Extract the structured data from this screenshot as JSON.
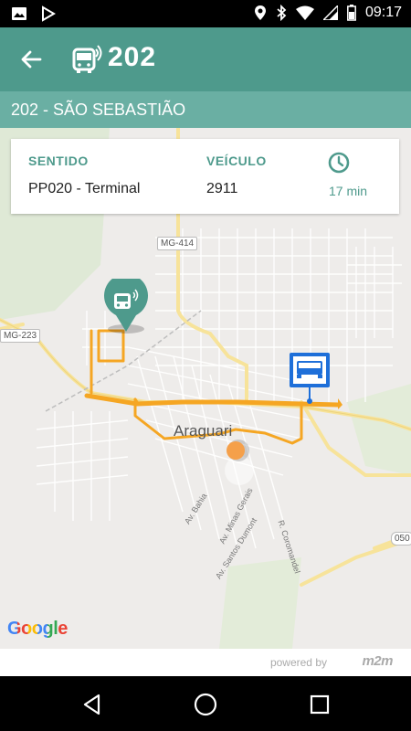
{
  "status_bar": {
    "time": "09:17",
    "icons": [
      "image-icon",
      "play-store-icon",
      "location-icon",
      "bluetooth-icon",
      "wifi-icon",
      "signal-icon",
      "battery-icon"
    ]
  },
  "header": {
    "route_number": "202",
    "back_icon": "arrow-left-icon",
    "logo_icon": "bus-signal-icon"
  },
  "route": {
    "name": "202 - SÃO SEBASTIÃO"
  },
  "info_card": {
    "direction_label": "SENTIDO",
    "direction_value": "PP020 - Terminal",
    "vehicle_label": "VEÍCULO",
    "vehicle_value": "2911",
    "eta_icon": "clock-icon",
    "eta_value": "17 min"
  },
  "map": {
    "city": "Araguari",
    "roads": [
      "MG-414",
      "MG-223",
      "050"
    ],
    "streets": [
      "Av. Bahia",
      "Av. Minas Gerais",
      "Av. Santos Dumont",
      "R. Coromandel"
    ],
    "attribution": "Google",
    "route_color": "#f5a623",
    "stop_marker_color": "#4e9a8c",
    "vehicle_marker_color": "#1e6fd9"
  },
  "footer": {
    "powered_by": "powered by",
    "brand": "m2m"
  },
  "colors": {
    "primary": "#4e9a8c",
    "primary_light": "#6aafa3",
    "accent": "#f5a623"
  }
}
